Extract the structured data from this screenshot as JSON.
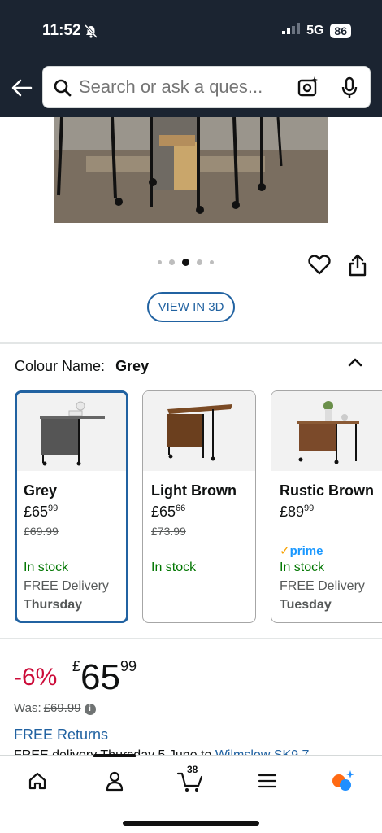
{
  "status": {
    "time": "11:52",
    "network": "5G",
    "battery": "86"
  },
  "search": {
    "placeholder": "Search or ask a ques..."
  },
  "gallery": {
    "dot_count": 5,
    "active_index": 2
  },
  "view3d_label": "VIEW IN 3D",
  "colour": {
    "label": "Colour Name:",
    "selected": "Grey"
  },
  "swatches": [
    {
      "name": "Grey",
      "price_whole": "£65",
      "price_frac": "99",
      "was": "£69.99",
      "prime": "",
      "stock": "In stock",
      "delivery": "FREE Delivery",
      "day": "Thursday"
    },
    {
      "name": "Light Brown",
      "price_whole": "£65",
      "price_frac": "66",
      "was": "£73.99",
      "prime": "",
      "stock": "In stock",
      "delivery": "",
      "day": ""
    },
    {
      "name": "Rustic Brown",
      "price_whole": "£89",
      "price_frac": "99",
      "was": "",
      "prime": "prime",
      "stock": "In stock",
      "delivery": "FREE Delivery",
      "day": "Tuesday"
    }
  ],
  "price": {
    "discount": "-6%",
    "currency": "£",
    "whole": "65",
    "cents": "99",
    "was_label": "Was:",
    "was_value": "£69.99"
  },
  "free_returns": "FREE Returns",
  "delivery_line": {
    "text": "FREE delivery Thursday 5 June to ",
    "link": "Wilmslow SK9 7"
  },
  "nav": {
    "cart_count": "38"
  },
  "colors": {
    "header_bg": "#1b2431",
    "link": "#2162a1",
    "discount": "#cc0c39",
    "stock": "#007600"
  }
}
